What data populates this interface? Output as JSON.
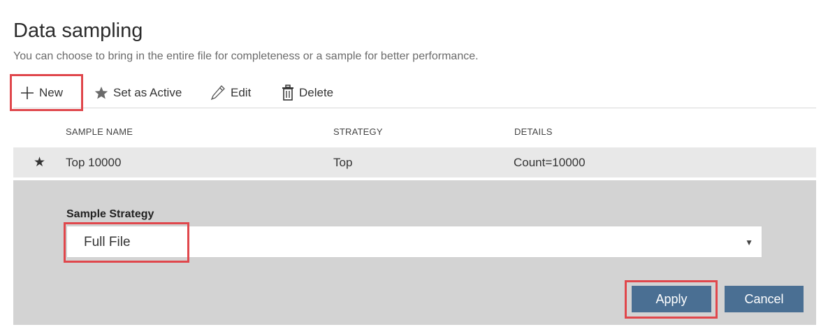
{
  "header": {
    "title": "Data sampling",
    "subtitle": "You can choose to bring in the entire file for completeness or a sample for better performance."
  },
  "toolbar": {
    "new_label": "New",
    "set_active_label": "Set as Active",
    "edit_label": "Edit",
    "delete_label": "Delete"
  },
  "table": {
    "columns": [
      "SAMPLE NAME",
      "STRATEGY",
      "DETAILS"
    ],
    "rows": [
      {
        "active_marker": "★",
        "name": "Top 10000",
        "strategy": "Top",
        "details": "Count=10000"
      }
    ]
  },
  "form": {
    "strategy_label": "Sample Strategy",
    "strategy_value": "Full File",
    "caret": "▼"
  },
  "actions": {
    "apply_label": "Apply",
    "cancel_label": "Cancel"
  },
  "colors": {
    "accent_button": "#4a6f93",
    "highlight": "#e0474c",
    "panel_bg": "#d3d3d3",
    "row_bg": "#e8e8e8"
  }
}
